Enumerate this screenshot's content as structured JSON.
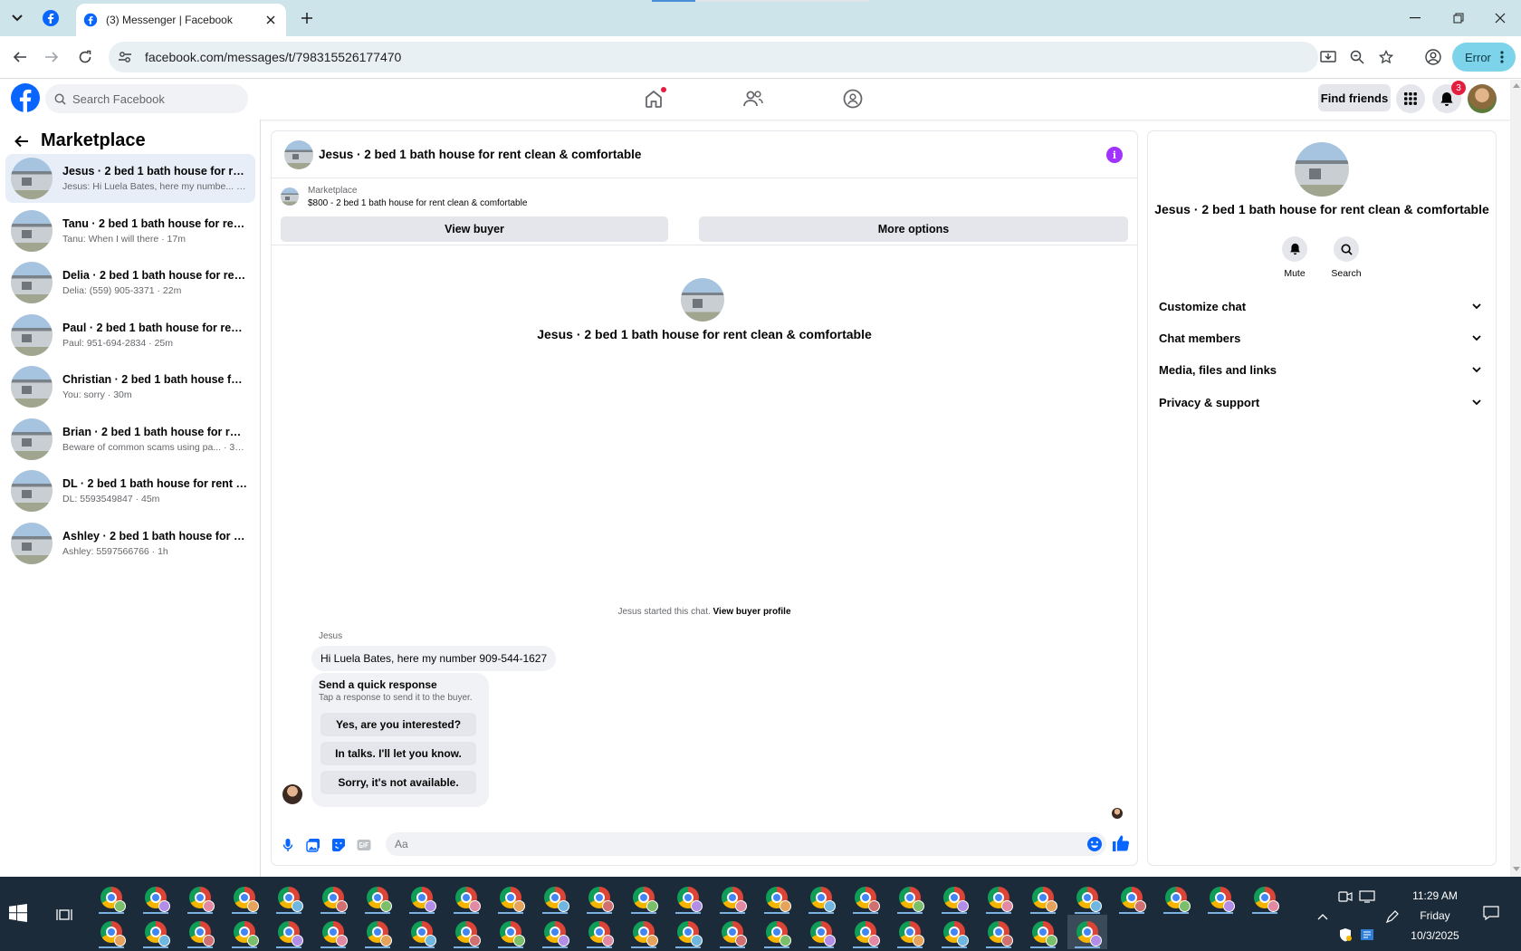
{
  "browser": {
    "tab_title": "(3) Messenger | Facebook",
    "url": "facebook.com/messages/t/798315526177470",
    "error_label": "Error"
  },
  "fb": {
    "search_placeholder": "Search Facebook",
    "find_friends": "Find friends",
    "notif_count": "3"
  },
  "sidebar": {
    "title": "Marketplace",
    "conversations": [
      {
        "name": "Jesus · 2 bed 1 bath house for rent ...",
        "preview": "Jesus: Hi Luela Bates, here my numbe... · 1m"
      },
      {
        "name": "Tanu · 2 bed 1 bath house for rent ...",
        "preview": "Tanu: When I will there · 17m"
      },
      {
        "name": "Delia · 2 bed 1 bath house for rent ...",
        "preview": "Delia: (559) 905-3371 · 22m"
      },
      {
        "name": "Paul · 2 bed 1 bath house for rent ...",
        "preview": "Paul: 951-694-2834 · 25m"
      },
      {
        "name": "Christian · 2 bed 1 bath house for r...",
        "preview": "You: sorry · 30m"
      },
      {
        "name": "Brian · 2 bed 1 bath house for rent ...",
        "preview": "Beware of common scams using pa... · 37m"
      },
      {
        "name": "DL · 2 bed 1 bath house for rent cl...",
        "preview": "DL: 5593549847 · 45m"
      },
      {
        "name": "Ashley · 2 bed 1 bath house for ren...",
        "preview": "Ashley: 5597566766 · 1h"
      }
    ]
  },
  "chat": {
    "title": "Jesus · 2 bed 1 bath house for rent clean & comfortable",
    "listing_label": "Marketplace",
    "listing_price": "$800 - 2 bed 1 bath house for rent clean & comfortable",
    "view_buyer": "View buyer",
    "more_options": "More options",
    "intro_title": "Jesus · 2 bed 1 bath house for rent clean & comfortable",
    "started_text": "Jesus started this chat.",
    "view_buyer_profile": "View buyer profile",
    "sender_name": "Jesus",
    "message": "Hi Luela Bates, here my number 909-544-1627",
    "quick_title": "Send a quick response",
    "quick_sub": "Tap a response to send it to the buyer.",
    "quick_options": [
      "Yes, are you interested?",
      "In talks. I'll let you know.",
      "Sorry, it's not available."
    ],
    "composer_placeholder": "Aa"
  },
  "rpanel": {
    "title": "Jesus · 2 bed 1 bath house for rent clean & comfortable",
    "mute": "Mute",
    "search": "Search",
    "sections": [
      "Customize chat",
      "Chat members",
      "Media, files and links",
      "Privacy & support"
    ]
  },
  "taskbar": {
    "time": "11:29 AM",
    "day": "Friday",
    "date": "10/3/2025"
  },
  "colors": {
    "fb_blue": "#0866ff",
    "messenger_purple": "#a033ff",
    "active_conv_bg": "#e7eef8"
  }
}
